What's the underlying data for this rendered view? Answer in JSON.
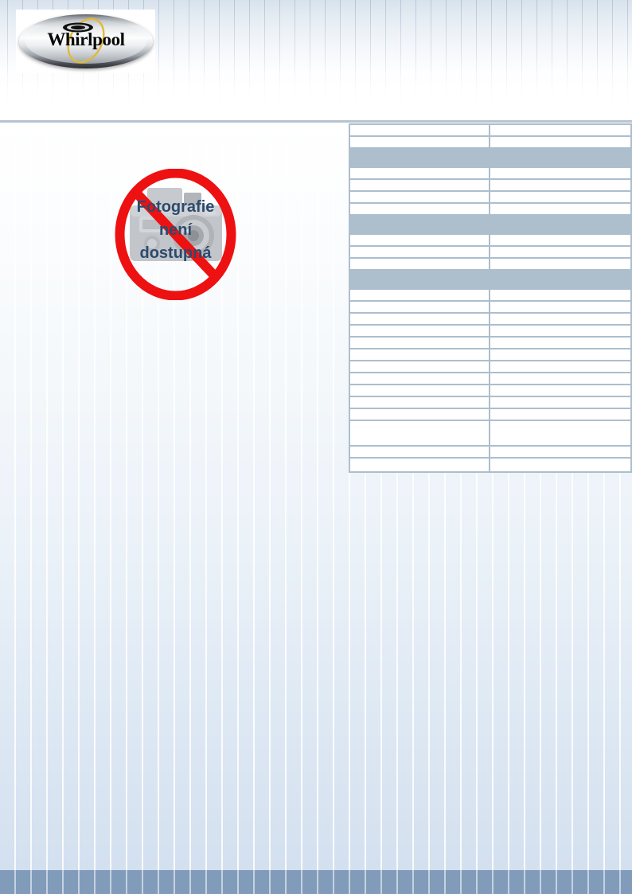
{
  "document": {
    "brand": "Whirlpool",
    "language": "cs",
    "page_size": "A4"
  },
  "header": {
    "logo": {
      "wordmark": "Whirlpool",
      "shape": "oval-badge",
      "swirl_color": "#e0b93c",
      "badge_colors": [
        "#2b2e32",
        "#fdfdfd",
        "#9ba1a7"
      ]
    }
  },
  "photo_placeholder": {
    "lines": [
      "Fotografie",
      "není",
      "dostupná"
    ],
    "full_text": "Fotografie není dostupná",
    "icon": "camera-icon",
    "overlay_icon": "no-photo-prohibition-icon",
    "text_color": "#2d4a6d",
    "ban_color": "#ee1111",
    "camera_color": "#b9bcc0"
  },
  "spec_table": {
    "columns": [
      "",
      ""
    ],
    "rows": [
      {
        "type": "data",
        "label": "",
        "value": ""
      },
      {
        "type": "data",
        "label": "",
        "value": ""
      },
      {
        "type": "section",
        "label": "",
        "value": ""
      },
      {
        "type": "data",
        "label": "",
        "value": ""
      },
      {
        "type": "data",
        "label": "",
        "value": ""
      },
      {
        "type": "data",
        "label": "",
        "value": ""
      },
      {
        "type": "data",
        "label": "",
        "value": ""
      },
      {
        "type": "section",
        "label": "",
        "value": ""
      },
      {
        "type": "data",
        "label": "",
        "value": ""
      },
      {
        "type": "data",
        "label": "",
        "value": ""
      },
      {
        "type": "data",
        "label": "",
        "value": ""
      },
      {
        "type": "section",
        "label": "",
        "value": ""
      },
      {
        "type": "data",
        "label": "",
        "value": ""
      },
      {
        "type": "data",
        "label": "",
        "value": ""
      },
      {
        "type": "data",
        "label": "",
        "value": ""
      },
      {
        "type": "data",
        "label": "",
        "value": ""
      },
      {
        "type": "data",
        "label": "",
        "value": ""
      },
      {
        "type": "data",
        "label": "",
        "value": ""
      },
      {
        "type": "data",
        "label": "",
        "value": ""
      },
      {
        "type": "data",
        "label": "",
        "value": ""
      },
      {
        "type": "data",
        "label": "",
        "value": ""
      },
      {
        "type": "data",
        "label": "",
        "value": ""
      },
      {
        "type": "data",
        "label": "",
        "value": ""
      },
      {
        "type": "tall",
        "label": "",
        "value": ""
      },
      {
        "type": "data",
        "label": "",
        "value": ""
      },
      {
        "type": "med",
        "label": "",
        "value": ""
      }
    ]
  },
  "colors": {
    "table_border": "#adbecd",
    "table_section_band": "#adbecd",
    "top_rule": "#b6c3d1",
    "footer_bar": "#819cba",
    "body_gradient_top": "#ffffff",
    "body_gradient_bottom": "#d3e0ef"
  }
}
